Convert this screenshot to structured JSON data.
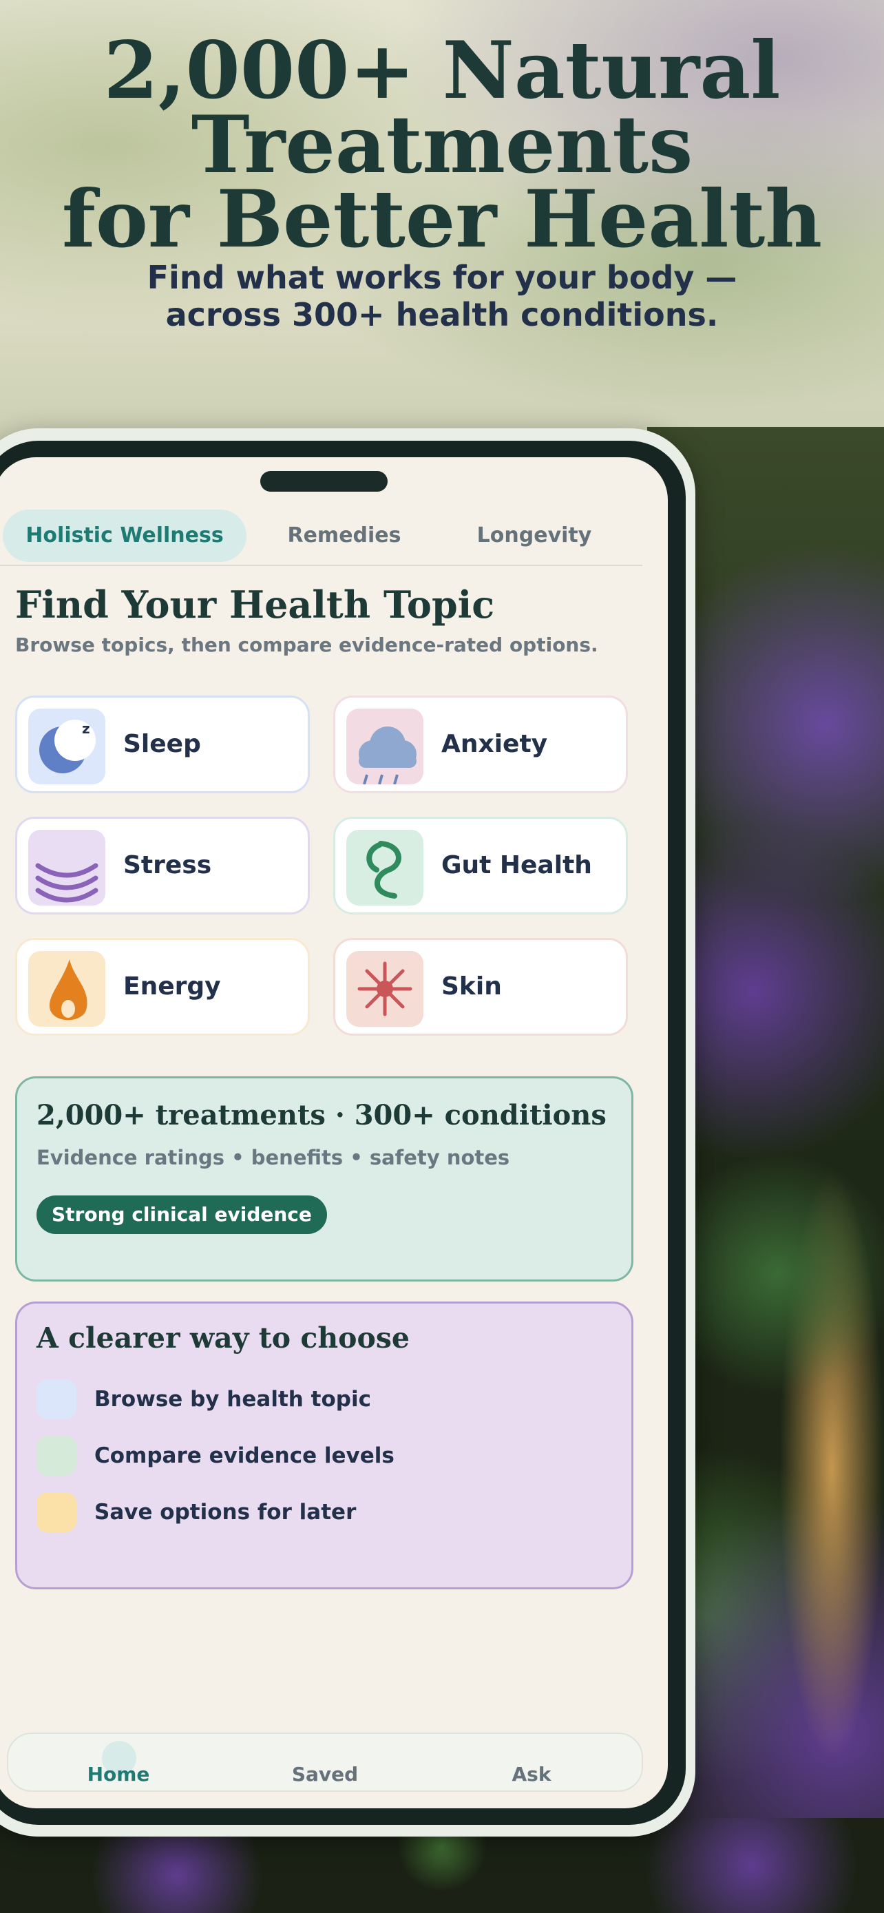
{
  "hero": {
    "headline_line1": "2,000+ Natural",
    "headline_line2": "Treatments",
    "headline_line3": "for Better Health",
    "subhead_line1": "Find what works for your body —",
    "subhead_line2": "across 300+ health conditions."
  },
  "tabs": [
    {
      "label": "Holistic Wellness",
      "active": true
    },
    {
      "label": "Remedies",
      "active": false
    },
    {
      "label": "Longevity",
      "active": false
    }
  ],
  "topics": {
    "title": "Find Your Health Topic",
    "subtitle": "Browse topics, then compare evidence-rated options.",
    "items": [
      {
        "label": "Sleep",
        "icon": "moon-icon",
        "icon_bg": "#dde7fb",
        "border": "#d6e0f5"
      },
      {
        "label": "Anxiety",
        "icon": "rain-cloud-icon",
        "icon_bg": "#f3dbe3",
        "border": "#f2dde3"
      },
      {
        "label": "Stress",
        "icon": "waves-icon",
        "icon_bg": "#e8ddf3",
        "border": "#e1d8f0"
      },
      {
        "label": "Gut Health",
        "icon": "gut-spiral-icon",
        "icon_bg": "#d9eee3",
        "border": "#d6ece2"
      },
      {
        "label": "Energy",
        "icon": "flame-icon",
        "icon_bg": "#fbe8c8",
        "border": "#f8ead0"
      },
      {
        "label": "Skin",
        "icon": "sparkle-icon",
        "icon_bg": "#f5ddd5",
        "border": "#f2dcd6"
      }
    ]
  },
  "stats": {
    "title": "2,000+ treatments · 300+ conditions",
    "subtitle": "Evidence ratings • benefits • safety notes",
    "badge": "Strong clinical evidence"
  },
  "choose": {
    "title": "A clearer way to choose",
    "items": [
      {
        "label": "Browse by health topic",
        "color": "#dce6fb"
      },
      {
        "label": "Compare evidence levels",
        "color": "#d6ead9"
      },
      {
        "label": "Save options for later",
        "color": "#fbe0a8"
      }
    ]
  },
  "nav": {
    "home": "Home",
    "saved": "Saved",
    "ask": "Ask"
  },
  "colors": {
    "accent": "#1e7b73",
    "dark_text": "#1e3a36",
    "badge": "#1f6b55"
  }
}
